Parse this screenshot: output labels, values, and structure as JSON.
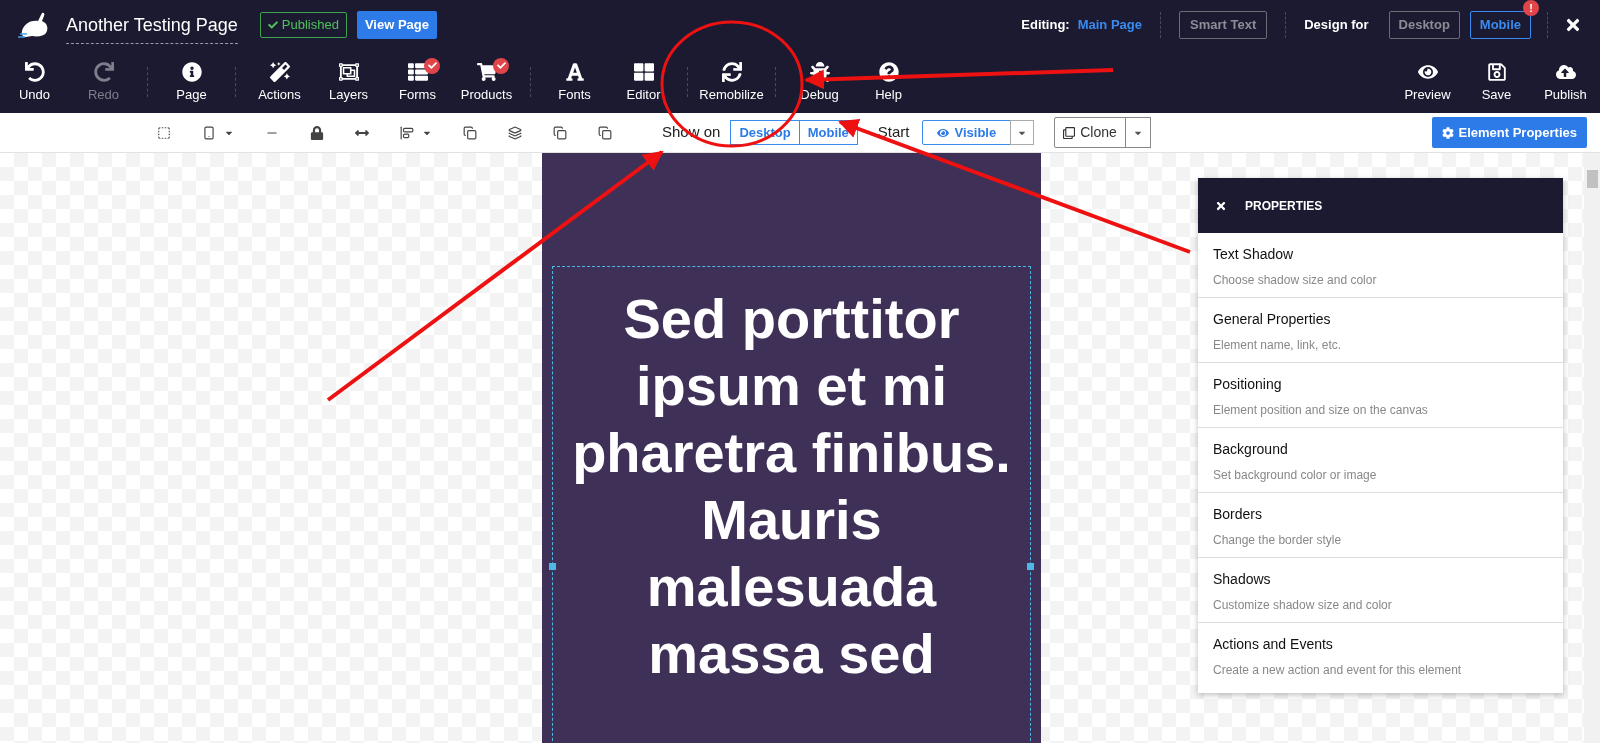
{
  "header": {
    "title": "Another Testing Page",
    "status": "Published",
    "view_button": "View Page",
    "editing_label": "Editing:",
    "editing_page": "Main Page",
    "smart_text": "Smart Text",
    "design_label": "Design for",
    "design_options": [
      {
        "label": "Desktop",
        "selected": false
      },
      {
        "label": "Mobile",
        "selected": true
      }
    ],
    "alert_badge": "!"
  },
  "toolbar": {
    "groups": [
      [
        {
          "kind": "undo",
          "label": "Undo",
          "disabled": false,
          "badge": false
        },
        {
          "kind": "redo",
          "label": "Redo",
          "disabled": true,
          "badge": false
        }
      ],
      [
        {
          "kind": "page",
          "label": "Page",
          "disabled": false,
          "badge": false
        }
      ],
      [
        {
          "kind": "actions",
          "label": "Actions",
          "disabled": false,
          "badge": false
        },
        {
          "kind": "layers",
          "label": "Layers",
          "disabled": false,
          "badge": false
        },
        {
          "kind": "forms",
          "label": "Forms",
          "disabled": false,
          "badge": true
        },
        {
          "kind": "products",
          "label": "Products",
          "disabled": false,
          "badge": true
        }
      ],
      [
        {
          "kind": "fonts",
          "label": "Fonts",
          "disabled": false,
          "badge": false
        },
        {
          "kind": "editor",
          "label": "Editor",
          "disabled": false,
          "badge": false
        }
      ],
      [
        {
          "kind": "remobilize",
          "label": "Remobilize",
          "disabled": false,
          "badge": false
        }
      ],
      [
        {
          "kind": "debug",
          "label": "Debug",
          "disabled": false,
          "badge": false
        },
        {
          "kind": "help",
          "label": "Help",
          "disabled": false,
          "badge": false
        }
      ]
    ],
    "right": [
      {
        "kind": "preview",
        "label": "Preview",
        "disabled": false,
        "badge": false
      },
      {
        "kind": "save",
        "label": "Save",
        "disabled": false,
        "badge": false
      },
      {
        "kind": "publish",
        "label": "Publish",
        "disabled": false,
        "badge": false
      }
    ]
  },
  "element_bar": {
    "show_on_label": "Show on",
    "show_on": [
      {
        "label": "Desktop",
        "on": true
      },
      {
        "label": "Mobile",
        "on": true
      }
    ],
    "start_label": "Start",
    "visibility": "Visible",
    "clone": "Clone",
    "properties_button": "Element Properties"
  },
  "canvas": {
    "heading_lines": [
      "Sed porttitor",
      "ipsum et mi",
      "pharetra finibus.",
      "Mauris",
      "malesuada",
      "massa sed"
    ]
  },
  "properties_panel": {
    "title": "PROPERTIES",
    "items": [
      {
        "title": "Text Shadow",
        "description": "Choose shadow size and color"
      },
      {
        "title": "General Properties",
        "description": "Element name, link, etc."
      },
      {
        "title": "Positioning",
        "description": "Element position and size on the canvas"
      },
      {
        "title": "Background",
        "description": "Set background color or image"
      },
      {
        "title": "Borders",
        "description": "Change the border style"
      },
      {
        "title": "Shadows",
        "description": "Customize shadow size and color"
      },
      {
        "title": "Actions and Events",
        "description": "Create a new action and event for this element"
      }
    ]
  }
}
